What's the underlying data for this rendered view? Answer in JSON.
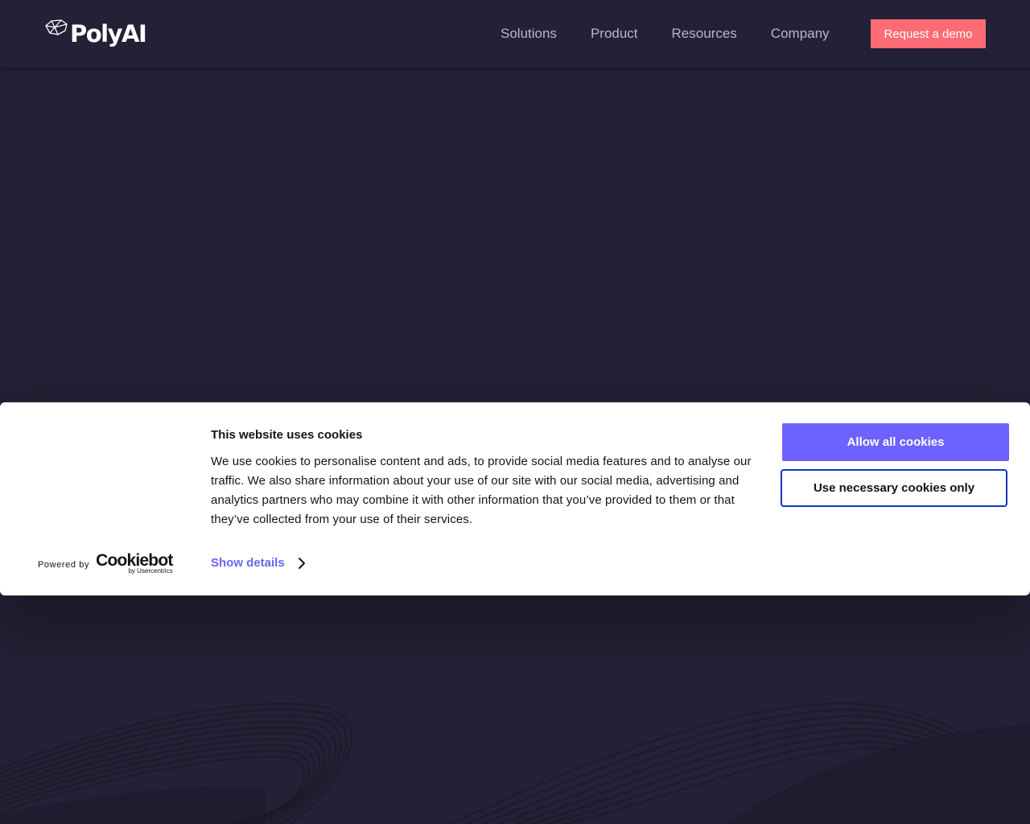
{
  "header": {
    "logo_text": "PolyAI",
    "logo_icon": "polyai-polyhedron-icon",
    "nav": [
      "Solutions",
      "Product",
      "Resources",
      "Company"
    ],
    "cta_label": "Request a demo"
  },
  "cookie_banner": {
    "title": "This website uses cookies",
    "body": "We use cookies to personalise content and ads, to provide social media features and to analyse our traffic. We also share information about your use of our site with our social media, advertising and analytics partners who may combine it with other information that you’ve provided to them or that they’ve collected from your use of their services.",
    "powered_by": "Powered by",
    "cookiebot_name": "Cookiebot",
    "cookiebot_sub": "by Usercentrics",
    "show_details": "Show details",
    "allow_all": "Allow all cookies",
    "necessary_only": "Use necessary cookies only"
  },
  "colors": {
    "background": "#222135",
    "accent_cta": "#fe6b75",
    "accent_primary": "#6c63ff",
    "link": "#6963f4",
    "outline": "#1032cf"
  }
}
